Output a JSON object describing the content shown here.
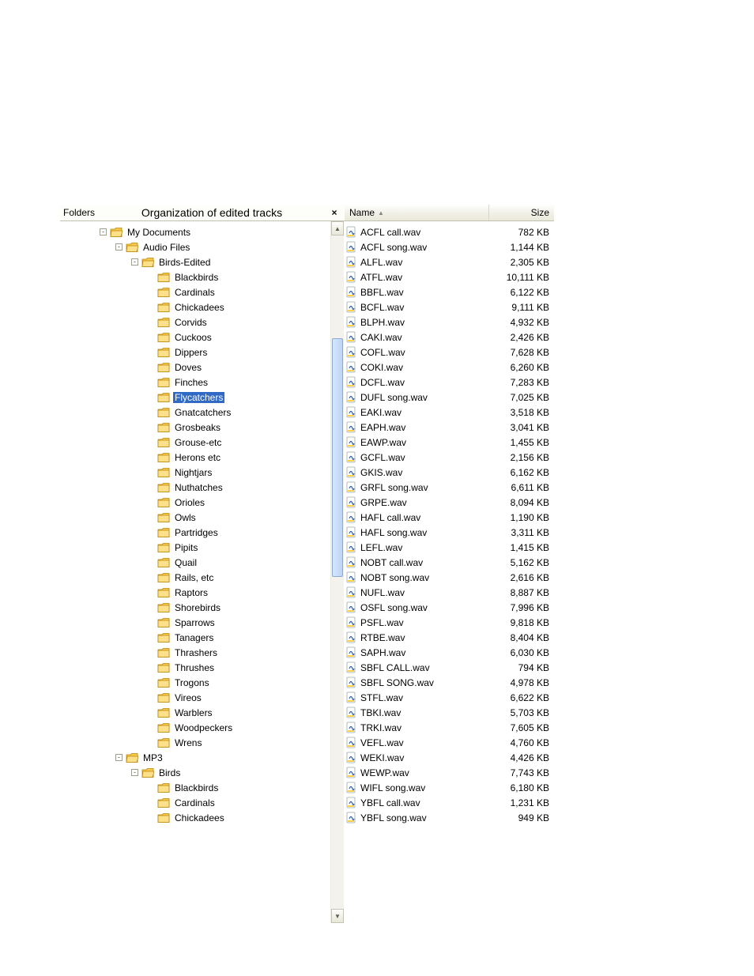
{
  "header": {
    "folders_label": "Folders",
    "center_title": "Organization of edited tracks",
    "close_glyph": "×",
    "col_name": "Name",
    "col_size": "Size",
    "sort_glyph": "▲"
  },
  "tree": [
    {
      "indent": 0,
      "expander": "-",
      "open": true,
      "label": "My Documents"
    },
    {
      "indent": 1,
      "expander": "-",
      "open": true,
      "label": "Audio Files"
    },
    {
      "indent": 2,
      "expander": "-",
      "open": true,
      "label": "Birds-Edited"
    },
    {
      "indent": 3,
      "expander": "",
      "open": false,
      "label": "Blackbirds"
    },
    {
      "indent": 3,
      "expander": "",
      "open": false,
      "label": "Cardinals"
    },
    {
      "indent": 3,
      "expander": "",
      "open": false,
      "label": "Chickadees"
    },
    {
      "indent": 3,
      "expander": "",
      "open": false,
      "label": "Corvids"
    },
    {
      "indent": 3,
      "expander": "",
      "open": false,
      "label": "Cuckoos"
    },
    {
      "indent": 3,
      "expander": "",
      "open": false,
      "label": "Dippers"
    },
    {
      "indent": 3,
      "expander": "",
      "open": false,
      "label": "Doves"
    },
    {
      "indent": 3,
      "expander": "",
      "open": false,
      "label": "Finches"
    },
    {
      "indent": 3,
      "expander": "",
      "open": false,
      "label": "Flycatchers",
      "selected": true
    },
    {
      "indent": 3,
      "expander": "",
      "open": false,
      "label": "Gnatcatchers"
    },
    {
      "indent": 3,
      "expander": "",
      "open": false,
      "label": "Grosbeaks"
    },
    {
      "indent": 3,
      "expander": "",
      "open": false,
      "label": "Grouse-etc"
    },
    {
      "indent": 3,
      "expander": "",
      "open": false,
      "label": "Herons etc"
    },
    {
      "indent": 3,
      "expander": "",
      "open": false,
      "label": "Nightjars"
    },
    {
      "indent": 3,
      "expander": "",
      "open": false,
      "label": "Nuthatches"
    },
    {
      "indent": 3,
      "expander": "",
      "open": false,
      "label": "Orioles"
    },
    {
      "indent": 3,
      "expander": "",
      "open": false,
      "label": "Owls"
    },
    {
      "indent": 3,
      "expander": "",
      "open": false,
      "label": "Partridges"
    },
    {
      "indent": 3,
      "expander": "",
      "open": false,
      "label": "Pipits"
    },
    {
      "indent": 3,
      "expander": "",
      "open": false,
      "label": "Quail"
    },
    {
      "indent": 3,
      "expander": "",
      "open": false,
      "label": "Rails, etc"
    },
    {
      "indent": 3,
      "expander": "",
      "open": false,
      "label": "Raptors"
    },
    {
      "indent": 3,
      "expander": "",
      "open": false,
      "label": "Shorebirds"
    },
    {
      "indent": 3,
      "expander": "",
      "open": false,
      "label": "Sparrows"
    },
    {
      "indent": 3,
      "expander": "",
      "open": false,
      "label": "Tanagers"
    },
    {
      "indent": 3,
      "expander": "",
      "open": false,
      "label": "Thrashers"
    },
    {
      "indent": 3,
      "expander": "",
      "open": false,
      "label": "Thrushes"
    },
    {
      "indent": 3,
      "expander": "",
      "open": false,
      "label": "Trogons"
    },
    {
      "indent": 3,
      "expander": "",
      "open": false,
      "label": "Vireos"
    },
    {
      "indent": 3,
      "expander": "",
      "open": false,
      "label": "Warblers"
    },
    {
      "indent": 3,
      "expander": "",
      "open": false,
      "label": "Woodpeckers"
    },
    {
      "indent": 3,
      "expander": "",
      "open": false,
      "label": "Wrens"
    },
    {
      "indent": 1,
      "expander": "-",
      "open": true,
      "label": "MP3"
    },
    {
      "indent": 2,
      "expander": "-",
      "open": true,
      "label": "Birds"
    },
    {
      "indent": 3,
      "expander": "",
      "open": false,
      "label": "Blackbirds"
    },
    {
      "indent": 3,
      "expander": "",
      "open": false,
      "label": "Cardinals"
    },
    {
      "indent": 3,
      "expander": "",
      "open": false,
      "label": "Chickadees"
    }
  ],
  "files": [
    {
      "name": "ACFL call.wav",
      "size": "782 KB"
    },
    {
      "name": "ACFL song.wav",
      "size": "1,144 KB"
    },
    {
      "name": "ALFL.wav",
      "size": "2,305 KB"
    },
    {
      "name": "ATFL.wav",
      "size": "10,111 KB"
    },
    {
      "name": "BBFL.wav",
      "size": "6,122 KB"
    },
    {
      "name": "BCFL.wav",
      "size": "9,111 KB"
    },
    {
      "name": "BLPH.wav",
      "size": "4,932 KB"
    },
    {
      "name": "CAKI.wav",
      "size": "2,426 KB"
    },
    {
      "name": "COFL.wav",
      "size": "7,628 KB"
    },
    {
      "name": "COKI.wav",
      "size": "6,260 KB"
    },
    {
      "name": "DCFL.wav",
      "size": "7,283 KB"
    },
    {
      "name": "DUFL song.wav",
      "size": "7,025 KB"
    },
    {
      "name": "EAKI.wav",
      "size": "3,518 KB"
    },
    {
      "name": "EAPH.wav",
      "size": "3,041 KB"
    },
    {
      "name": "EAWP.wav",
      "size": "1,455 KB"
    },
    {
      "name": "GCFL.wav",
      "size": "2,156 KB"
    },
    {
      "name": "GKIS.wav",
      "size": "6,162 KB"
    },
    {
      "name": "GRFL song.wav",
      "size": "6,611 KB"
    },
    {
      "name": "GRPE.wav",
      "size": "8,094 KB"
    },
    {
      "name": "HAFL call.wav",
      "size": "1,190 KB"
    },
    {
      "name": "HAFL song.wav",
      "size": "3,311 KB"
    },
    {
      "name": "LEFL.wav",
      "size": "1,415 KB"
    },
    {
      "name": "NOBT call.wav",
      "size": "5,162 KB"
    },
    {
      "name": "NOBT song.wav",
      "size": "2,616 KB"
    },
    {
      "name": "NUFL.wav",
      "size": "8,887 KB"
    },
    {
      "name": "OSFL song.wav",
      "size": "7,996 KB"
    },
    {
      "name": "PSFL.wav",
      "size": "9,818 KB"
    },
    {
      "name": "RTBE.wav",
      "size": "8,404 KB"
    },
    {
      "name": "SAPH.wav",
      "size": "6,030 KB"
    },
    {
      "name": "SBFL CALL.wav",
      "size": "794 KB"
    },
    {
      "name": "SBFL SONG.wav",
      "size": "4,978 KB"
    },
    {
      "name": "STFL.wav",
      "size": "6,622 KB"
    },
    {
      "name": "TBKI.wav",
      "size": "5,703 KB"
    },
    {
      "name": "TRKI.wav",
      "size": "7,605 KB"
    },
    {
      "name": "VEFL.wav",
      "size": "4,760 KB"
    },
    {
      "name": "WEKI.wav",
      "size": "4,426 KB"
    },
    {
      "name": "WEWP.wav",
      "size": "7,743 KB"
    },
    {
      "name": "WIFL song.wav",
      "size": "6,180 KB"
    },
    {
      "name": "YBFL call.wav",
      "size": "1,231 KB"
    },
    {
      "name": "YBFL song.wav",
      "size": "949 KB"
    }
  ]
}
